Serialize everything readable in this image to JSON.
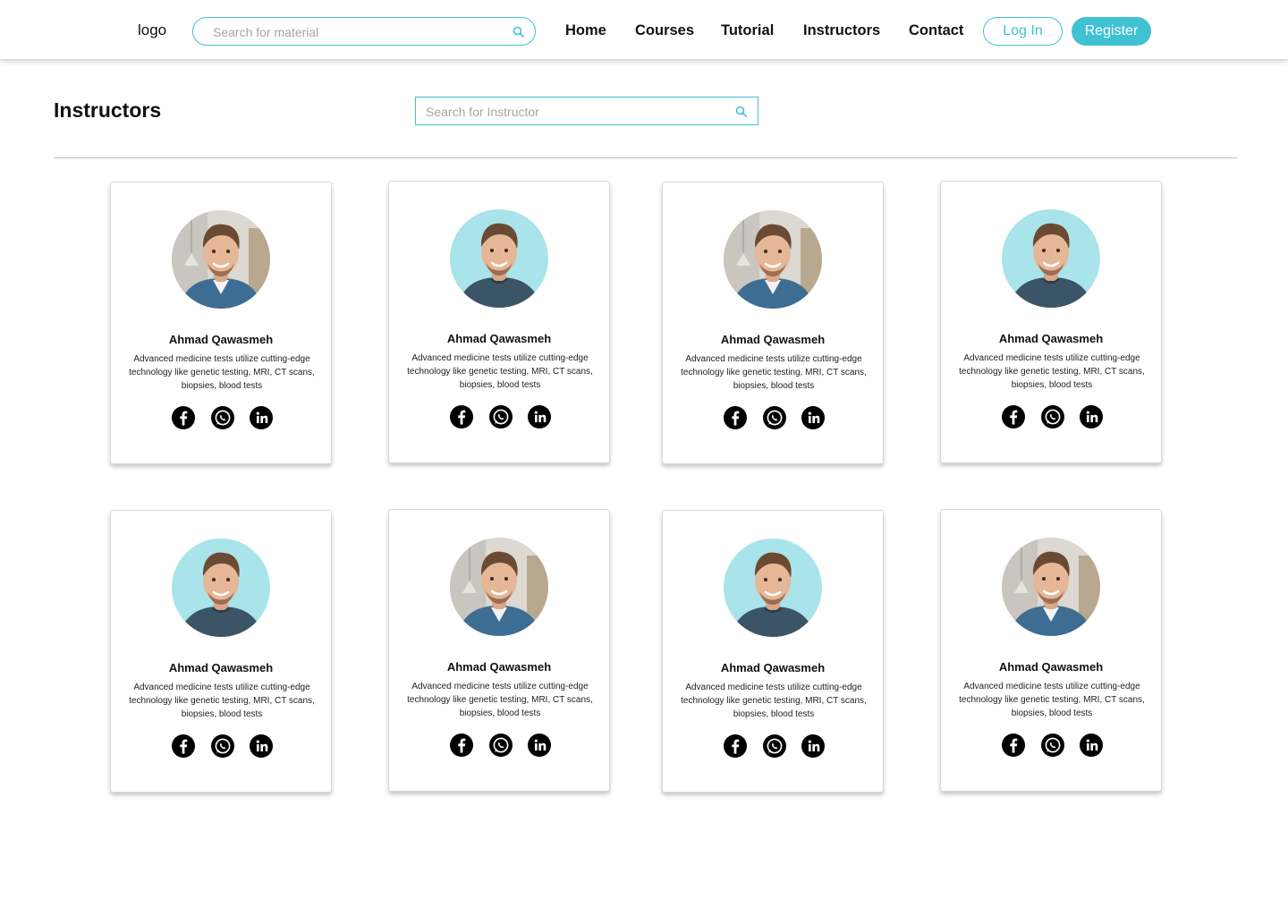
{
  "header": {
    "logo": "logo",
    "search_placeholder": "Search for material",
    "nav": [
      "Home",
      "Courses",
      "Tutorial",
      "Instructors",
      "Contact"
    ],
    "login_label": "Log In",
    "register_label": "Register"
  },
  "page": {
    "title": "Instructors",
    "search_placeholder": "Search for Instructor"
  },
  "colors": {
    "accent": "#3fc2d4",
    "avatar_bg_cyan": "#a8e4ea"
  },
  "instructors": [
    {
      "name": "Ahmad Qawasmeh",
      "description": "Advanced medicine tests utilize cutting-edge technology like genetic testing, MRI, CT scans, biopsies, blood tests",
      "photo": "photo-room",
      "socials": [
        "facebook-icon",
        "whatsapp-icon",
        "linkedin-icon"
      ]
    },
    {
      "name": "Ahmad Qawasmeh",
      "description": "Advanced medicine tests utilize cutting-edge technology like genetic testing, MRI, CT scans, biopsies, blood tests",
      "photo": "photo-cyan",
      "socials": [
        "facebook-icon",
        "whatsapp-icon",
        "linkedin-icon"
      ]
    },
    {
      "name": "Ahmad Qawasmeh",
      "description": "Advanced medicine tests utilize cutting-edge technology like genetic testing, MRI, CT scans, biopsies, blood tests",
      "photo": "photo-room",
      "socials": [
        "facebook-icon",
        "whatsapp-icon",
        "linkedin-icon"
      ]
    },
    {
      "name": "Ahmad Qawasmeh",
      "description": "Advanced medicine tests utilize cutting-edge technology like genetic testing, MRI, CT scans, biopsies, blood tests",
      "photo": "photo-cyan",
      "socials": [
        "facebook-icon",
        "whatsapp-icon",
        "linkedin-icon"
      ]
    },
    {
      "name": "Ahmad Qawasmeh",
      "description": "Advanced medicine tests utilize cutting-edge technology like genetic testing, MRI, CT scans, biopsies, blood tests",
      "photo": "photo-cyan",
      "socials": [
        "facebook-icon",
        "whatsapp-icon",
        "linkedin-icon"
      ]
    },
    {
      "name": "Ahmad Qawasmeh",
      "description": "Advanced medicine tests utilize cutting-edge technology like genetic testing, MRI, CT scans, biopsies, blood tests",
      "photo": "photo-room",
      "socials": [
        "facebook-icon",
        "whatsapp-icon",
        "linkedin-icon"
      ]
    },
    {
      "name": "Ahmad Qawasmeh",
      "description": "Advanced medicine tests utilize cutting-edge technology like genetic testing, MRI, CT scans, biopsies, blood tests",
      "photo": "photo-cyan",
      "socials": [
        "facebook-icon",
        "whatsapp-icon",
        "linkedin-icon"
      ]
    },
    {
      "name": "Ahmad Qawasmeh",
      "description": "Advanced medicine tests utilize cutting-edge technology like genetic testing, MRI, CT scans, biopsies, blood tests",
      "photo": "photo-room",
      "socials": [
        "facebook-icon",
        "whatsapp-icon",
        "linkedin-icon"
      ]
    }
  ]
}
